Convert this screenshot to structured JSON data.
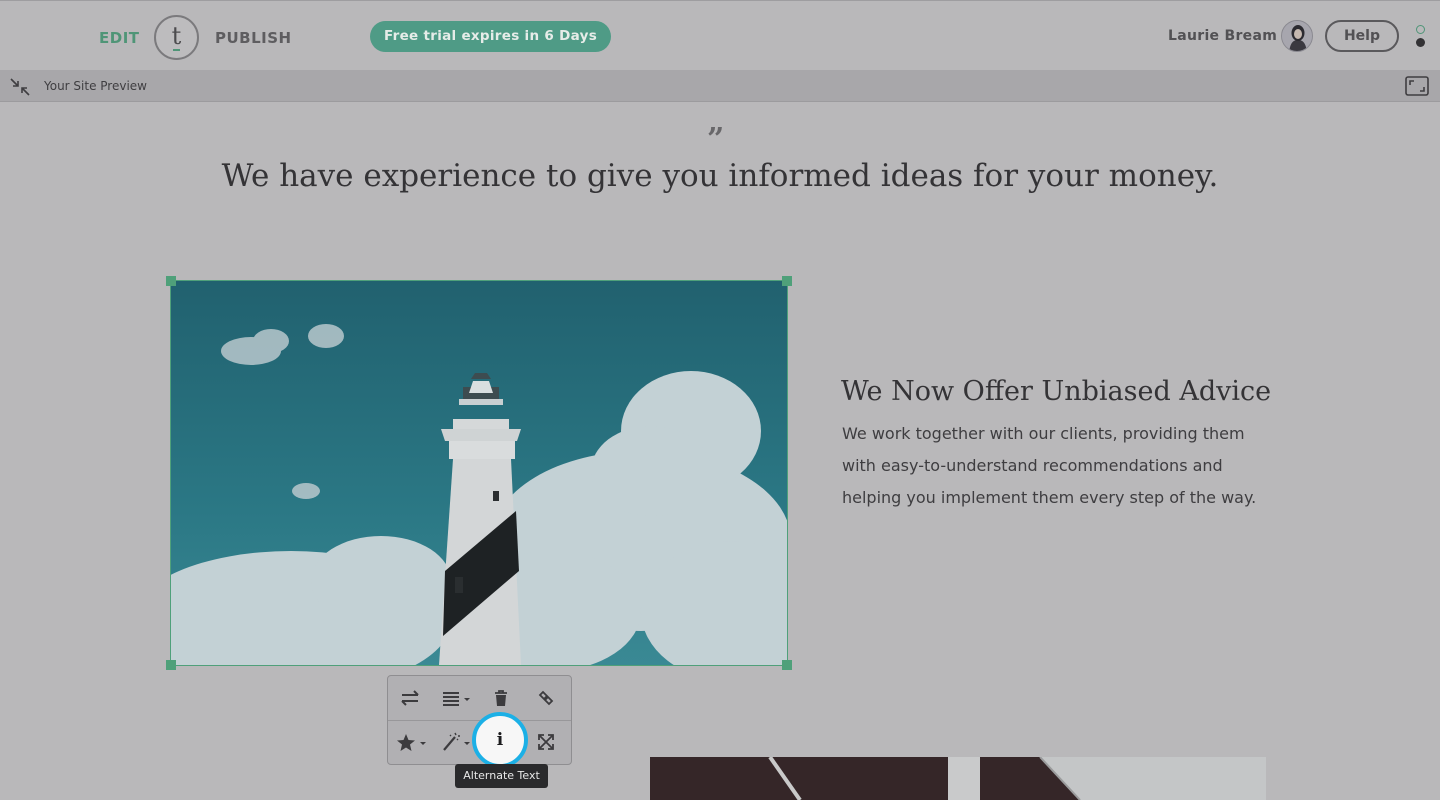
{
  "header": {
    "edit_label": "EDIT",
    "logo_letter": "t",
    "publish_label": "PUBLISH",
    "trial_badge": "Free trial expires in 6 Days",
    "user_name": "Laurie Bream",
    "help_label": "Help"
  },
  "preview_bar": {
    "label": "Your Site Preview"
  },
  "content": {
    "quote_mark": "”",
    "headline": "We have experience to give you informed ideas for your money.",
    "section_title": "We Now Offer Unbiased Advice",
    "section_body": "We work together with our clients, providing them with easy-to-understand recommendations and helping you implement them every step of the way."
  },
  "image_toolbar": {
    "row1": [
      "swap-icon",
      "align-icon",
      "trash-icon",
      "link-icon"
    ],
    "row2": [
      "star-icon",
      "magic-wand-icon",
      "info-icon",
      "fullscreen-icon"
    ],
    "alt_text_glyph": "i",
    "tooltip": "Alternate Text"
  },
  "colors": {
    "accent_green": "#4f9577",
    "trial_badge": "#4f9b86",
    "focus_ring": "#1cb0e6",
    "overlay_gray": "#b9b8ba"
  }
}
